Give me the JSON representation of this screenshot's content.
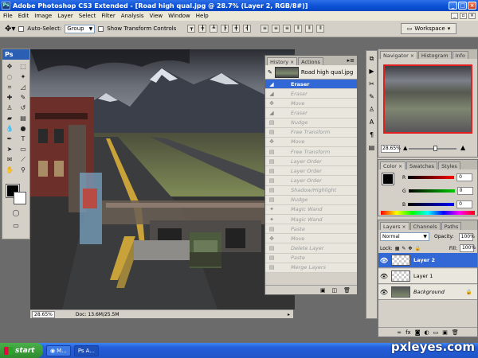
{
  "window": {
    "title": "Adobe Photoshop CS3 Extended - [Road high qual.jpg @ 28.7% (Layer 2, RGB/8#)]"
  },
  "menu": [
    "File",
    "Edit",
    "Image",
    "Layer",
    "Select",
    "Filter",
    "Analysis",
    "View",
    "Window",
    "Help"
  ],
  "options": {
    "auto_select_label": "Auto-Select:",
    "auto_select_value": "Group",
    "transform_label": "Show Transform Controls",
    "workspace_label": "Workspace"
  },
  "toolbox": {
    "logo": "Ps"
  },
  "status": {
    "zoom": "28.65%",
    "doc": "Doc: 13.6M/25.5M"
  },
  "history": {
    "tabs": [
      "History",
      "Actions"
    ],
    "snapshot": "Road high qual.jpg",
    "items": [
      "Eraser",
      "Eraser",
      "Move",
      "Eraser",
      "Nudge",
      "Free Transform",
      "Move",
      "Free Transform",
      "Layer Order",
      "Layer Order",
      "Layer Order",
      "Shadow/Highlight",
      "Nudge",
      "Magic Wand",
      "Magic Wand",
      "Paste",
      "Move",
      "Delete Layer",
      "Paste",
      "Merge Layers"
    ]
  },
  "navigator": {
    "tabs": [
      "Navigator",
      "Histogram",
      "Info"
    ],
    "zoom": "28.65%"
  },
  "color": {
    "tabs": [
      "Color",
      "Swatches",
      "Styles"
    ],
    "r": "0",
    "g": "0",
    "b": "0",
    "r_label": "R",
    "g_label": "G",
    "b_label": "B"
  },
  "layers": {
    "tabs": [
      "Layers",
      "Channels",
      "Paths"
    ],
    "blend": "Normal",
    "opacity_label": "Opacity:",
    "opacity": "100%",
    "lock_label": "Lock:",
    "fill_label": "Fill:",
    "fill": "100%",
    "items": [
      "Layer 2",
      "Layer 1",
      "Background"
    ]
  },
  "taskbar": {
    "start": "start",
    "items": [
      "M...",
      "A..."
    ]
  },
  "watermark": "pxleyes.com",
  "colors": {
    "title_bar": "#0a4fd4",
    "selection": "#3168d5",
    "panel": "#d4d0c8",
    "taskbar": "#245edb"
  }
}
